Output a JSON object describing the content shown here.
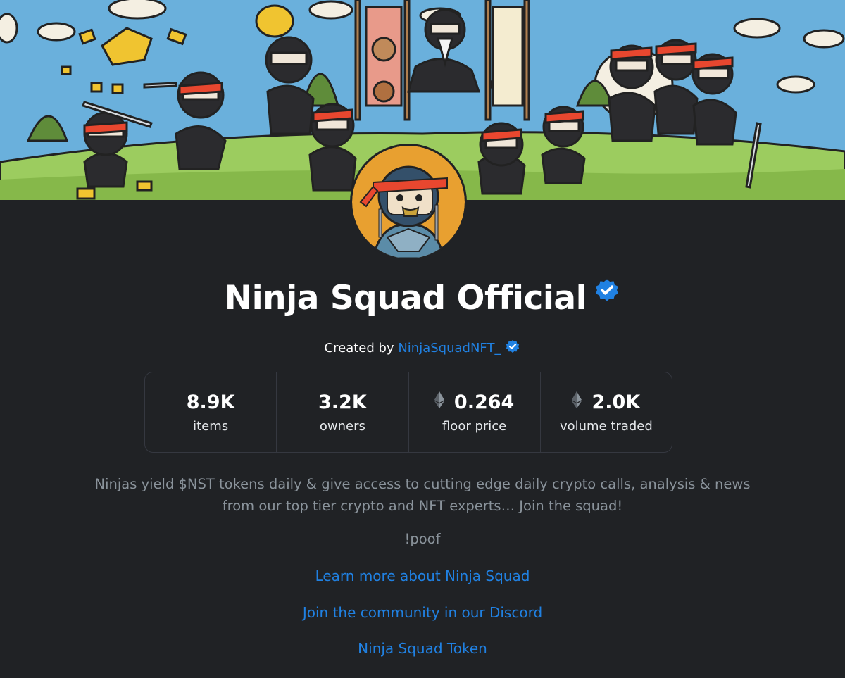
{
  "collection": {
    "name": "Ninja Squad Official",
    "created_by_prefix": "Created by",
    "creator_handle": "NinjaSquadNFT_"
  },
  "stats": [
    {
      "value": "8.9K",
      "label": "items",
      "eth_icon": false
    },
    {
      "value": "3.2K",
      "label": "owners",
      "eth_icon": false
    },
    {
      "value": "0.264",
      "label": "floor price",
      "eth_icon": true
    },
    {
      "value": "2.0K",
      "label": "volume traded",
      "eth_icon": true
    }
  ],
  "description": {
    "line1": "Ninjas yield $NST tokens daily & give access to cutting edge daily crypto calls, analysis & news",
    "line2": "from our top tier crypto and NFT experts… Join the squad!",
    "poof": "!poof"
  },
  "links": [
    {
      "label": "Learn more about Ninja Squad"
    },
    {
      "label": "Join the community in our Discord"
    },
    {
      "label": "Ninja Squad Token"
    }
  ],
  "colors": {
    "background": "#202225",
    "accent_link": "#2081e2",
    "verified_badge": "#2081e2",
    "headband": "#e8472f",
    "avatar_bg": "#e8a030"
  }
}
